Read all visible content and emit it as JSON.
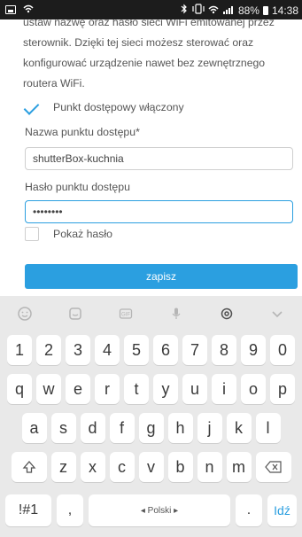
{
  "status_bar": {
    "battery_text": "88%",
    "time": "14:38",
    "icons": [
      "image-icon",
      "wifi-icon",
      "bluetooth-icon",
      "vibrate-icon",
      "wifi-signal-icon",
      "cell-signal-icon",
      "battery-icon"
    ]
  },
  "form": {
    "paragraph_lines": [
      "ustaw nazwę oraz hasło sieci WiFi emitowanej przez",
      "sterownik. Dzięki tej sieci możesz sterować oraz",
      "konfigurować urządzenie nawet bez zewnętrznego",
      "routera WiFi."
    ],
    "access_point_enabled_label": "Punkt dostępowy włączony",
    "ssid_label": "Nazwa punktu dostępu*",
    "ssid_value": "shutterBox-kuchnia",
    "password_label": "Hasło punktu dostępu",
    "password_value": "••••••••",
    "show_password_label": "Pokaż hasło",
    "save_label": "zapisz"
  },
  "keyboard": {
    "toolbar_icons": [
      "emoji-icon",
      "sticker-icon",
      "gif-icon",
      "mic-icon",
      "settings-icon",
      "collapse-icon"
    ],
    "numbers": [
      "1",
      "2",
      "3",
      "4",
      "5",
      "6",
      "7",
      "8",
      "9",
      "0"
    ],
    "row1": [
      "q",
      "w",
      "e",
      "r",
      "t",
      "y",
      "u",
      "i",
      "o",
      "p"
    ],
    "row2": [
      "a",
      "s",
      "d",
      "f",
      "g",
      "h",
      "j",
      "k",
      "l"
    ],
    "row3": [
      "z",
      "x",
      "c",
      "v",
      "b",
      "n",
      "m"
    ],
    "symbols_label": "!#1",
    "comma_label": ",",
    "space_label": "◂ Polski ▸",
    "period_label": ".",
    "enter_label": "Idź"
  }
}
